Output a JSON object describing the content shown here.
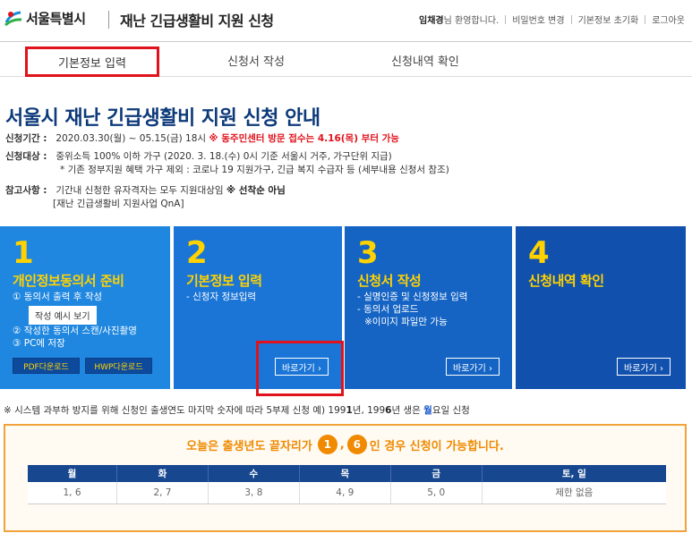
{
  "header": {
    "logo_text": "서울특별시",
    "title": "재난 긴급생활비 지원 신청",
    "user_name": "임채경",
    "welcome_suffix": "님 환영합니다.",
    "links": [
      "비밀번호 변경",
      "기본정보 초기화",
      "로그아웃"
    ]
  },
  "tabs": [
    "기본정보 입력",
    "신청서 작성",
    "신청내역 확인"
  ],
  "page_title": "서울시 재난 긴급생활비 지원 신청 안내",
  "info": {
    "period_label": "신청기간 :",
    "period_value": "2020.03.30(월) ~ 05.15(금) 18시",
    "period_note_a": "※ 동주민센터 방문 접수는 ",
    "period_note_b": "4.16(목)",
    "period_note_c": " 부터 가능",
    "target_label": "신청대상 :",
    "target_line1": "중위소득 100% 이하 가구 (2020. 3. 18.(수) 0시 기준 서울시 거주, 가구단위 지급)",
    "target_line2": "* 기존 정부지원 혜택 가구 제외 : 코로나 19 지원가구, 긴급 복지 수급자 등 (세부내용 신청서 참조)",
    "ref_label": "참고사항 :",
    "ref_line1a": "기간내 신청한 유자격자는 모두 지원대상임 ",
    "ref_line1b": "※ 선착순 아님",
    "ref_line2": "[재난 긴급생활비 지원사업 QnA]"
  },
  "cards": [
    {
      "num": "1",
      "title": "개인정보동의서 준비",
      "lines": [
        "① 동의서 출력 후 작성"
      ],
      "example_button": "작성 예시 보기",
      "lines2": [
        "② 작성한 동의서 스캔/사진촬영",
        "③ PC에 저장"
      ],
      "pdf_button": "PDF다운로드",
      "hwp_button": "HWP다운로드"
    },
    {
      "num": "2",
      "title": "기본정보 입력",
      "lines": [
        "- 신청자 정보입력"
      ],
      "go_button": "바로가기 ›"
    },
    {
      "num": "3",
      "title": "신청서 작성",
      "lines": [
        "- 실명인증 및 신청정보 입력",
        "- 동의서 업로드",
        "  ※이미지 파일만 가능"
      ],
      "go_button": "바로가기 ›"
    },
    {
      "num": "4",
      "title": "신청내역 확인",
      "lines": [],
      "go_button": "바로가기 ›"
    }
  ],
  "notice": {
    "text_a": "※ 시스템 과부하 방지를 위해 신청인 출생연도 마지막 숫자에 따라 5부제 신청   예) 199",
    "bold1": "1",
    "text_b": "년, 199",
    "bold2": "6",
    "text_c": "년 생은 ",
    "blue": "월",
    "text_d": "요일 신청"
  },
  "schedule": {
    "head_a": "오늘은 출생년도 끝자리가",
    "digit1": "1",
    "comma": ",",
    "digit2": "6",
    "head_b": "인 경우 신청이 가능합니다.",
    "headers": [
      "월",
      "화",
      "수",
      "목",
      "금",
      "토, 일"
    ],
    "values": [
      "1, 6",
      "2, 7",
      "3, 8",
      "4, 9",
      "5, 0",
      "제한 없음"
    ]
  },
  "colors": {
    "brand_blue": "#0d3a7a",
    "highlight_red": "#e0121b",
    "accent_yellow": "#ffd200",
    "accent_orange": "#f08a00"
  }
}
